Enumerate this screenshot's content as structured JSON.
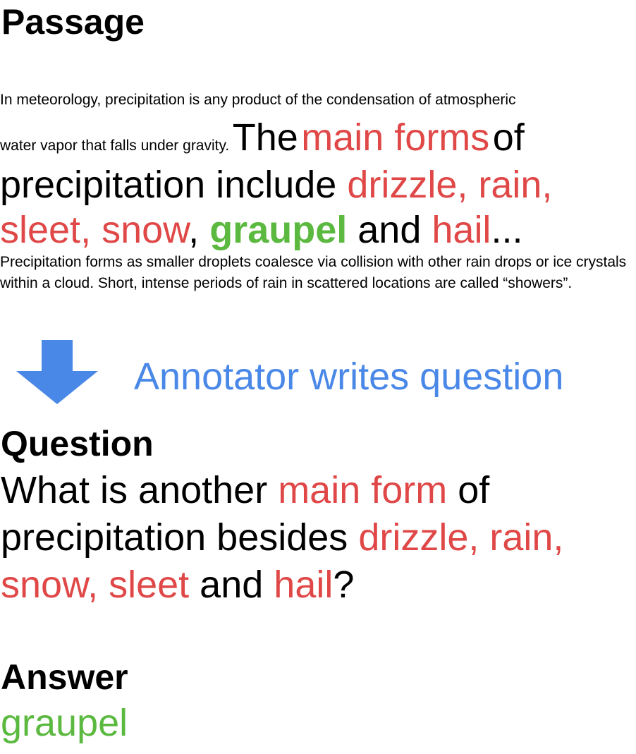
{
  "passage": {
    "title": "Passage",
    "line1": "In meteorology, precipitation is any product of the condensation of atmospheric",
    "line2_small": "water vapor that falls under gravity.",
    "line2_the": "The",
    "line2_main_forms": "main forms",
    "line2_of": "of",
    "line3_precip": "precipitation include",
    "line3_drizzle_rain": "drizzle, rain,",
    "line4_sleet_snow": "sleet, snow",
    "line4_comma": ",",
    "line4_graupel": "graupel",
    "line4_and": "and",
    "line4_hail": "hail",
    "line4_ellipsis": "...",
    "tail": "Precipitation forms as smaller droplets coalesce via collision with other rain drops or ice crystals within a cloud. Short, intense periods of rain in scattered locations are called “showers”."
  },
  "arrow": {
    "icon": "down-arrow-icon",
    "color": "#4A88E8"
  },
  "annotator_label": "Annotator writes question",
  "question": {
    "title": "Question",
    "part1": "What is another",
    "main_form": "main form",
    "part2": "of precipitation besides",
    "drizzle_rain": "drizzle, rain,",
    "snow_sleet": "snow, sleet",
    "and": "and",
    "hail": "hail",
    "qmark": "?"
  },
  "answer": {
    "title": "Answer",
    "value": "graupel"
  },
  "colors": {
    "highlight_red": "#E04848",
    "answer_green": "#5BB940",
    "annotator_blue": "#4A88E8",
    "text": "#000000"
  }
}
